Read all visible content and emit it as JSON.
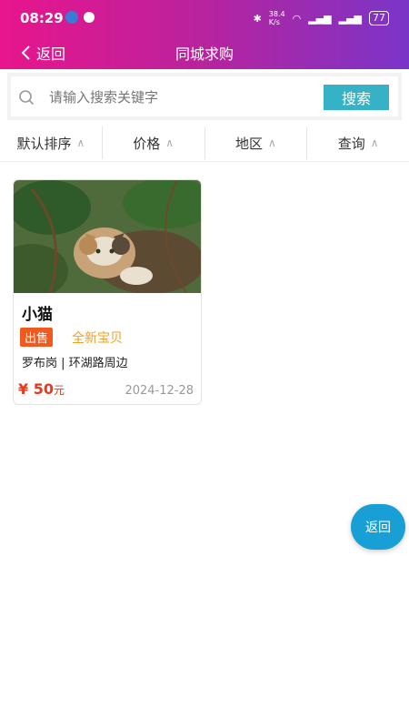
{
  "status_bar": {
    "time": "08:29",
    "net_speed_top": "38.4",
    "net_speed_bottom": "K/s",
    "battery": "77"
  },
  "nav": {
    "back_label": "返回",
    "title": "同城求购"
  },
  "search": {
    "placeholder": "请输入搜索关键字",
    "button_label": "搜索"
  },
  "filters": [
    {
      "label": "默认排序"
    },
    {
      "label": "价格"
    },
    {
      "label": "地区"
    },
    {
      "label": "查询"
    }
  ],
  "items": [
    {
      "name": "小猫",
      "tag": "出售",
      "condition": "全新宝贝",
      "location": "罗布岗 | 环湖路周边",
      "price": "¥ 50",
      "price_unit": "元",
      "date": "2024-12-28",
      "image": "cat-photo"
    }
  ],
  "fab": {
    "label": "返回"
  },
  "colors": {
    "header_start": "#e8158c",
    "header_end": "#7a35c8",
    "search_button": "#35b2c6",
    "tag": "#f05a1e",
    "price": "#e8391c",
    "fab": "#18a0d6"
  }
}
